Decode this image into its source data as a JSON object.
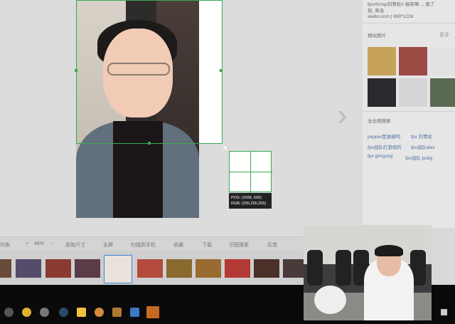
{
  "sidebar": {
    "title_line1": "fpx#fcrisp刘青松# 搞笑啊 ... 真了",
    "title_line2": "现, 来自",
    "source": "weibo.com | 690*1226",
    "similar_label": "相似图片",
    "more_label": "更多",
    "search_label": "全全网搜索",
    "tags": [
      "pepper是谁被吗",
      "fpx 刘青松",
      "fpx战队打游戏的",
      "fpx战队alex",
      "fpx gimgoog",
      "fpx战队 pubg"
    ]
  },
  "magnifier": {
    "pos_text": "POS: (1099, 600)",
    "rgb_text": "RGB: (255,255,255)"
  },
  "toolbar": {
    "list_label": "列表",
    "zoom_out": "+",
    "zoom_value": "48%",
    "zoom_in": "−",
    "original_size": "原始尺寸",
    "fullscreen": "全屏",
    "send_to_phone": "扫描到手机",
    "favorite": "收藏",
    "download": "下载",
    "similar_search": "识图搜索",
    "feedback": "反馈"
  },
  "colors": {
    "selection_green": "#3aa84f",
    "filmstrip_highlight": "#3b82d8",
    "taskbar_bg": "#0a0a0a"
  },
  "taskbar": {
    "icons": [
      "settings-icon",
      "browser-icon",
      "game-icon",
      "steam-icon",
      "app-icon",
      "character-icon",
      "game2-icon",
      "media-icon",
      "app2-icon"
    ]
  }
}
